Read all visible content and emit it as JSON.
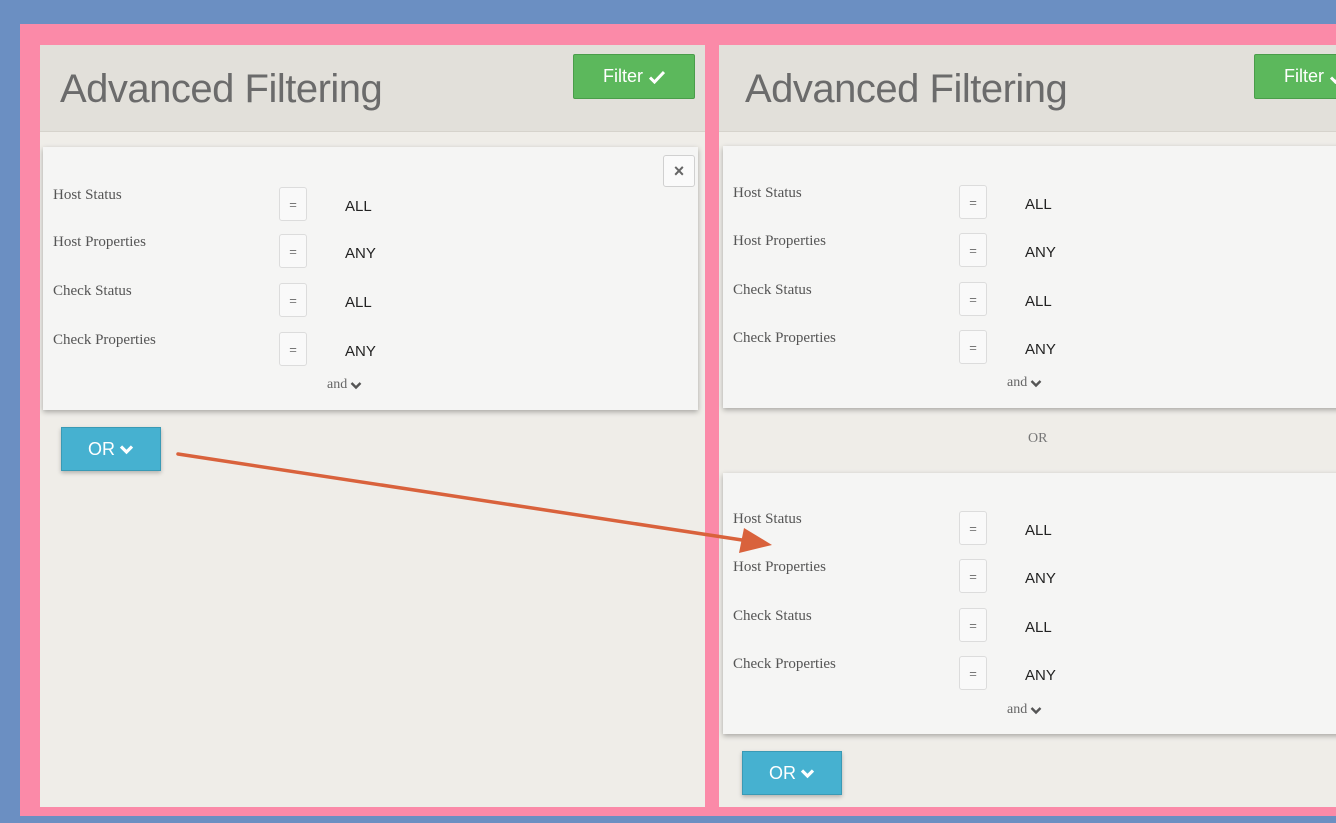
{
  "left_panel": {
    "title": "Advanced Filtering",
    "filter_label": "Filter",
    "close_glyph": "×",
    "group": {
      "rows": [
        {
          "label": "Host Status",
          "op": "=",
          "value": "ALL"
        },
        {
          "label": "Host Properties",
          "op": "=",
          "value": "ANY"
        },
        {
          "label": "Check Status",
          "op": "=",
          "value": "ALL"
        },
        {
          "label": "Check Properties",
          "op": "=",
          "value": "ANY"
        }
      ],
      "and_label": "and"
    },
    "or_button_label": "OR"
  },
  "right_panel": {
    "title": "Advanced Filtering",
    "filter_label": "Filter",
    "groups": [
      {
        "rows": [
          {
            "label": "Host Status",
            "op": "=",
            "value": "ALL"
          },
          {
            "label": "Host Properties",
            "op": "=",
            "value": "ANY"
          },
          {
            "label": "Check Status",
            "op": "=",
            "value": "ALL"
          },
          {
            "label": "Check Properties",
            "op": "=",
            "value": "ANY"
          }
        ],
        "and_label": "and"
      },
      {
        "rows": [
          {
            "label": "Host Status",
            "op": "=",
            "value": "ALL"
          },
          {
            "label": "Host Properties",
            "op": "=",
            "value": "ANY"
          },
          {
            "label": "Check Status",
            "op": "=",
            "value": "ALL"
          },
          {
            "label": "Check Properties",
            "op": "=",
            "value": "ANY"
          }
        ],
        "and_label": "and"
      }
    ],
    "or_separator": "OR",
    "or_button_label": "OR"
  },
  "icons": {
    "filter_check": "check-icon",
    "chevron": "chevron-down-icon",
    "close": "close-icon"
  },
  "colors": {
    "outer_background": "#6b8fc2",
    "frame": "#fb8aa8",
    "filter_button": "#5cb85c",
    "or_button": "#46b1d0",
    "annotation_arrow": "#d9623c"
  }
}
